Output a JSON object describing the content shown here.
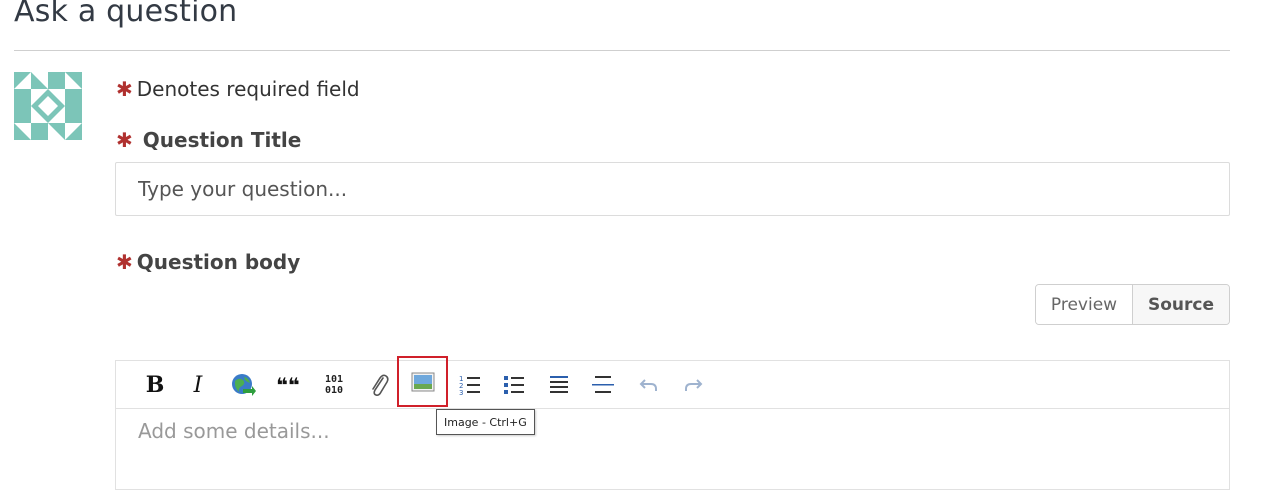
{
  "page": {
    "title": "Ask a question"
  },
  "form": {
    "required_star": "✱",
    "required_note": "Denotes required field",
    "question_title_label": "Question Title",
    "question_title_placeholder": "Type your question...",
    "question_body_label": "Question body"
  },
  "editor": {
    "modes": [
      {
        "label": "Preview",
        "active": false
      },
      {
        "label": "Source",
        "active": true
      }
    ],
    "toolbar_icons": [
      "bold-icon",
      "italic-icon",
      "link-icon",
      "quote-icon",
      "code-icon",
      "attachment-icon",
      "image-icon",
      "numbered-list-icon",
      "bulleted-list-icon",
      "heading-icon",
      "horizontal-rule-icon",
      "undo-icon",
      "redo-icon"
    ],
    "bold_glyph": "B",
    "italic_glyph": "I",
    "quote_glyph": "❝❝",
    "code_glyph_top": "101",
    "code_glyph_bottom": "010",
    "body_placeholder": "Add some details...",
    "tooltip": "Image - Ctrl+G"
  },
  "colors": {
    "required": "#b0312f",
    "highlight": "#d0202a",
    "avatar": "#7cc5b8"
  }
}
